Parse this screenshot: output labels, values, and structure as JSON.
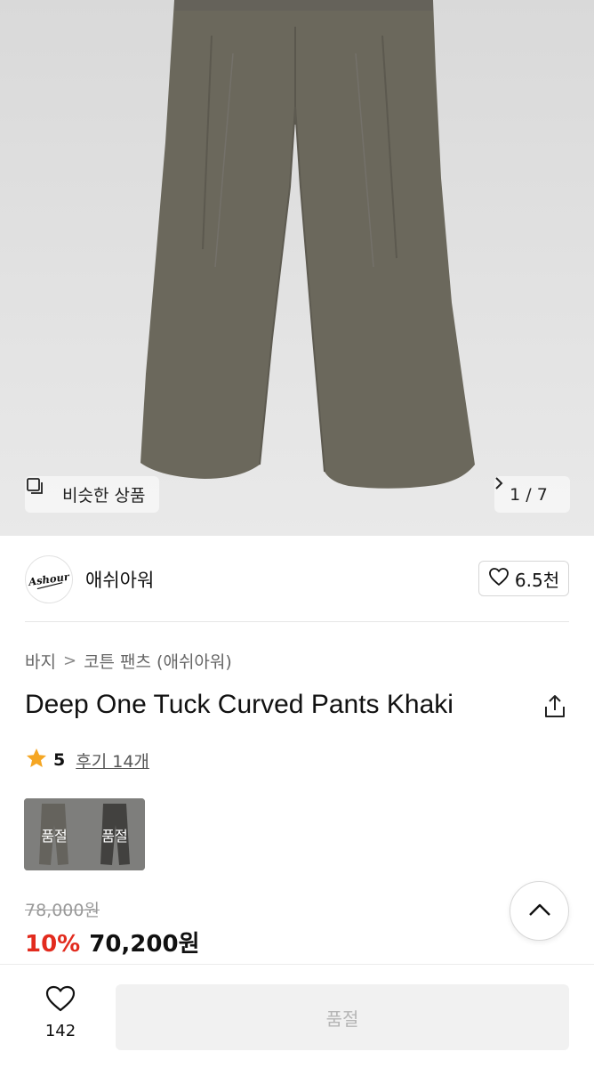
{
  "gallery": {
    "similar_label": "비슷한 상품",
    "pager_text": "1 / 7",
    "icons": {
      "similar": "copy-icon",
      "next": "chevron-right-icon"
    }
  },
  "brand": {
    "logo_text": "Ashour",
    "name": "애쉬아워",
    "like_count": "6.5천",
    "like_icon": "heart-outline-icon"
  },
  "breadcrumb": {
    "level1": "바지",
    "separator": ">",
    "level2": "코튼 팬츠 (애쉬아워)"
  },
  "product": {
    "title": "Deep One Tuck Curved Pants Khaki",
    "rating": {
      "score": "5",
      "reviews": "후기 14개"
    },
    "colors": [
      {
        "label": "품절",
        "color": "#6e6a60"
      },
      {
        "label": "품절",
        "color": "#2e2d29"
      }
    ],
    "price": {
      "original": "78,000원",
      "discount": "10%",
      "final": "70,200원"
    },
    "accent_color": "#e22b1e"
  },
  "bottom_bar": {
    "wish_count": "142",
    "buy_label": "품절"
  }
}
